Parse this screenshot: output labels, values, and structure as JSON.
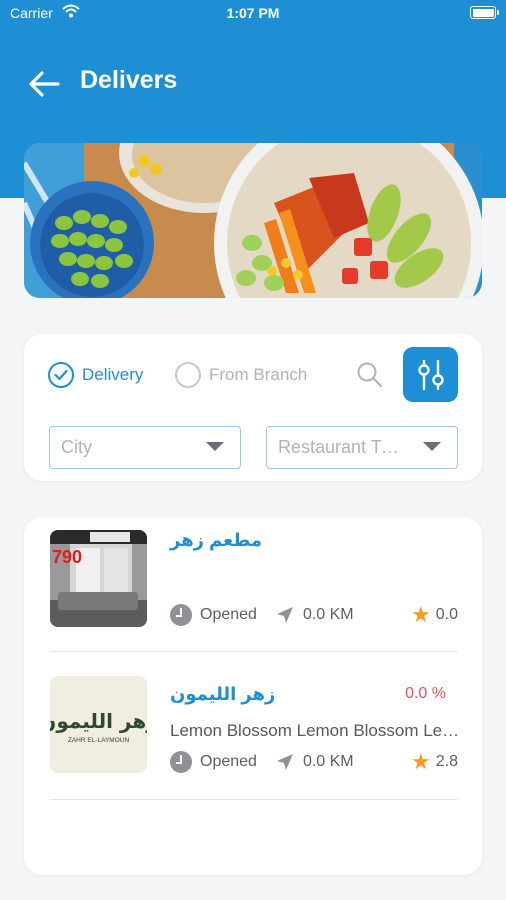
{
  "status_bar": {
    "carrier": "Carrier",
    "time": "1:07 PM"
  },
  "header": {
    "title": "Delivers",
    "back_icon": "arrow-left-icon"
  },
  "filters": {
    "options": [
      {
        "label": "Delivery",
        "selected": true
      },
      {
        "label": "From Branch",
        "selected": false
      }
    ],
    "city_placeholder": "City",
    "restaurant_type_placeholder": "Restaurant Type"
  },
  "restaurants": [
    {
      "name": "مطعم زهر",
      "status": "Opened",
      "distance": "0.0 KM",
      "rating": "0.0"
    },
    {
      "name": "زهر الليمون",
      "discount": "0.0 %",
      "description": "Lemon Blossom Lemon Blossom Lemon Blossom",
      "status": "Opened",
      "distance": "0.0 KM",
      "rating": "2.8",
      "logo_arabic": "زهر الليمون",
      "logo_latin": "ZAHR EL-LAYMOUN"
    }
  ],
  "thumb_overlay": {
    "text": "790"
  },
  "colors": {
    "primary": "#1f8fd5",
    "discount": "#ef4e5e",
    "star": "#f59b22"
  }
}
